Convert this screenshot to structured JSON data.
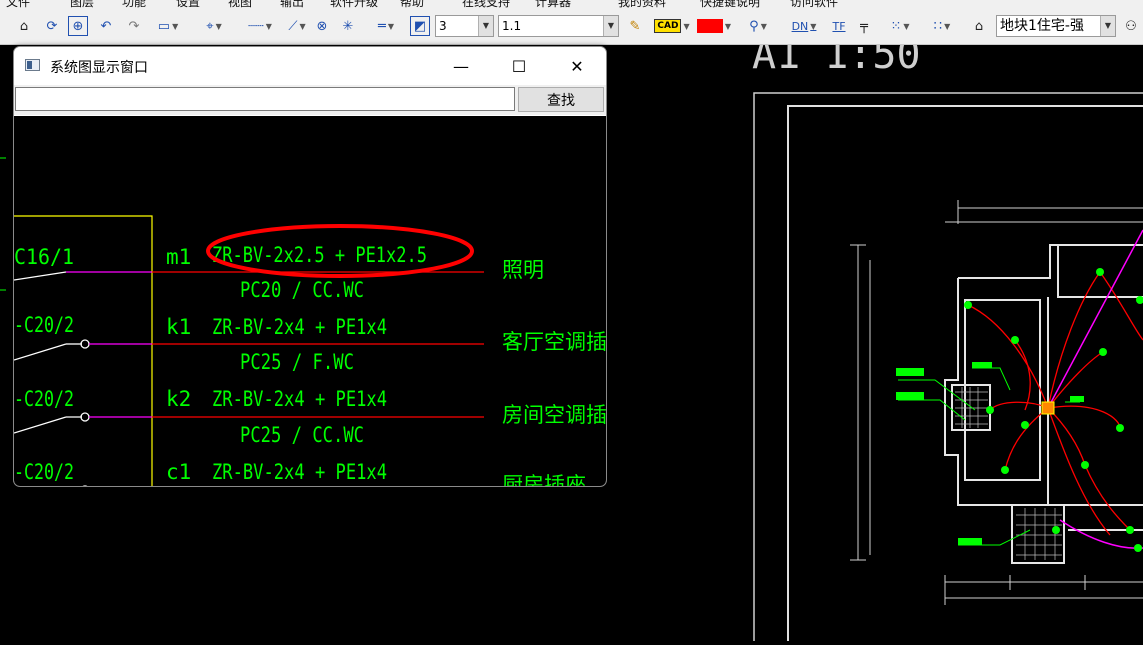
{
  "toolbar": {
    "layer_count": "3",
    "line_scale": "1.1",
    "cad_label": "CAD",
    "dn_label": "DN",
    "tf_label": "TF",
    "block_name": "地块1住宅-强"
  },
  "drawing": {
    "plan_title": "A1 1:50",
    "line_color": "#ff0000",
    "text_color": "#00ff00",
    "branch_color": "#ff00ff"
  },
  "dialog": {
    "title": "系统图显示窗口",
    "minimize_glyph": "—",
    "maximize_glyph": "☐",
    "close_glyph": "✕",
    "search_value": "",
    "find_label": "查找"
  },
  "circuits": [
    {
      "breaker": "C16/1",
      "id": "m1",
      "cable": "ZR-BV-2x2.5 + PE1x2.5",
      "conduit": "PC20 / CC.WC",
      "load": "照明",
      "highlighted": true
    },
    {
      "breaker": "-C20/2",
      "id": "k1",
      "cable": "ZR-BV-2x4 + PE1x4",
      "conduit": "PC25 / F.WC",
      "load": "客厅空调插座",
      "highlighted": false
    },
    {
      "breaker": "-C20/2",
      "id": "k2",
      "cable": "ZR-BV-2x4 + PE1x4",
      "conduit": "PC25 / CC.WC",
      "load": "房间空调插座",
      "highlighted": false
    },
    {
      "breaker": "-C20/2",
      "id": "c1",
      "cable": "ZR-BV-2x4 + PE1x4",
      "conduit": "",
      "load": "厨房插座",
      "highlighted": false
    }
  ]
}
